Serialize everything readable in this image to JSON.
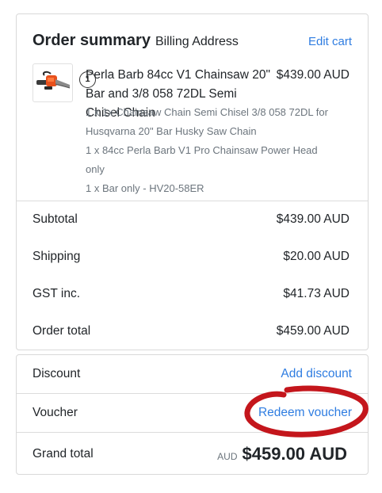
{
  "summary": {
    "title": "Order summary",
    "billing_label": "Billing Address",
    "edit_cart_label": "Edit cart"
  },
  "product": {
    "quantity": "1",
    "name": "Perla Barb 84cc V1 Chainsaw 20\" Bar and 3/8 058 72DL Semi Chisel Chain",
    "price": "$439.00 AUD",
    "options": [
      "1 x 1x Chainsaw Chain Semi Chisel 3/8 058 72DL for Husqvarna 20\" Bar Husky Saw Chain",
      "1 x 84cc Perla Barb V1 Pro Chainsaw Power Head only",
      "1 x Bar only - HV20-58ER"
    ]
  },
  "totals": {
    "subtotal_label": "Subtotal",
    "subtotal_value": "$439.00 AUD",
    "shipping_label": "Shipping",
    "shipping_value": "$20.00 AUD",
    "gst_label": "GST inc.",
    "gst_value": "$41.73 AUD",
    "order_total_label": "Order total",
    "order_total_value": "$459.00 AUD"
  },
  "extras": {
    "discount_label": "Discount",
    "add_discount_label": "Add discount",
    "voucher_label": "Voucher",
    "redeem_voucher_label": "Redeem voucher",
    "grand_total_label": "Grand total",
    "grand_total_currency": "AUD",
    "grand_total_value": "$459.00 AUD"
  },
  "colors": {
    "link": "#2f7de1",
    "annotation": "#c4161c"
  }
}
